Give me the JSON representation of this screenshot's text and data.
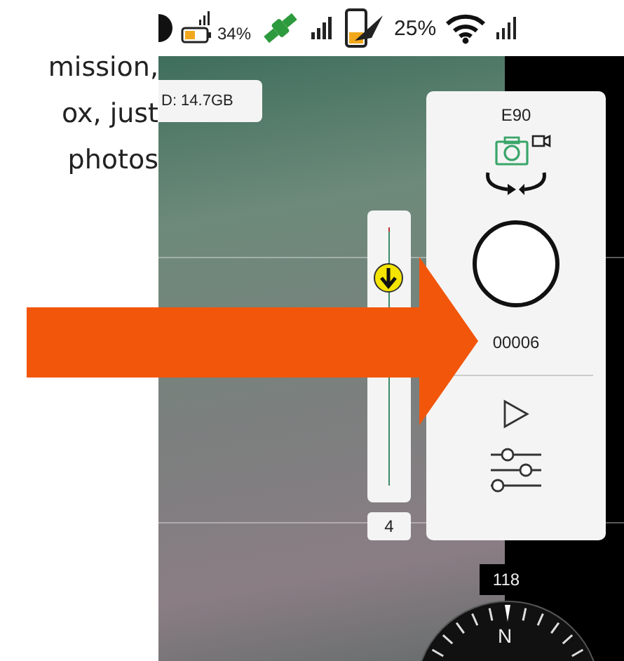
{
  "caption_lines": [
    "mission,",
    "ox, just",
    "photos"
  ],
  "status_bar": {
    "drone_battery": "34%",
    "controller_battery": "25%"
  },
  "storage": {
    "text": "D: 14.7GB"
  },
  "camera_panel": {
    "model": "E90",
    "photo_count": "00006"
  },
  "zoom_slider": {
    "level": 0.82,
    "reading": "4"
  },
  "compass": {
    "heading": "118",
    "north": "N"
  }
}
